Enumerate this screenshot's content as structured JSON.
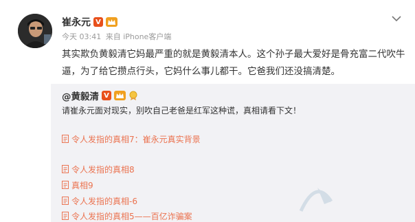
{
  "post": {
    "author": "崔永元",
    "time": "今天 03:41",
    "source": "来自 iPhone客户端",
    "content": "其实欺负黄毅清它妈最严重的就是黄毅清本人。这个孙子最大爱好是骨充富二代吹牛逼，为了给它攒点行头，它妈什么事儿都干。它爸我们还没搞清楚。",
    "badge_v": "V"
  },
  "repost": {
    "author": "@黄毅清",
    "badge_v": "V",
    "text": "请崔永元面对现实，别吹自己老爸是红军这种谎，真相请看下文！",
    "links": [
      "令人发指的真相7：崔永元真实背景",
      "令人发指的真相8",
      "真相9",
      "令人发指的真相-6",
      "令人发指的真相5——百亿诈骗案"
    ]
  },
  "colors": {
    "link": "#eb7350",
    "repost_bg": "#f2f2f5",
    "meta": "#999999",
    "badge_v": "#e8501c"
  },
  "icons": {
    "menu": "chevron-down-icon",
    "link": "document-icon"
  }
}
